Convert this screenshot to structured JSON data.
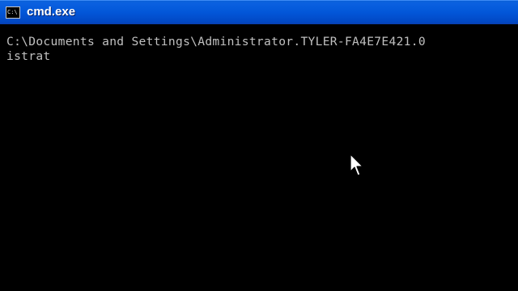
{
  "window": {
    "title": "cmd.exe",
    "icon": "console-icon",
    "icon_glyph": "C:\\"
  },
  "console": {
    "lines": [
      "C:\\Documents and Settings\\Administrator.TYLER-FA4E7E421.0",
      "istrat"
    ],
    "text_color": "#c0c0c0",
    "background_color": "#000000"
  },
  "pointer": {
    "icon": "mouse-pointer-icon"
  },
  "colors": {
    "titlebar": "#0256d8",
    "title_text": "#ffffff"
  }
}
